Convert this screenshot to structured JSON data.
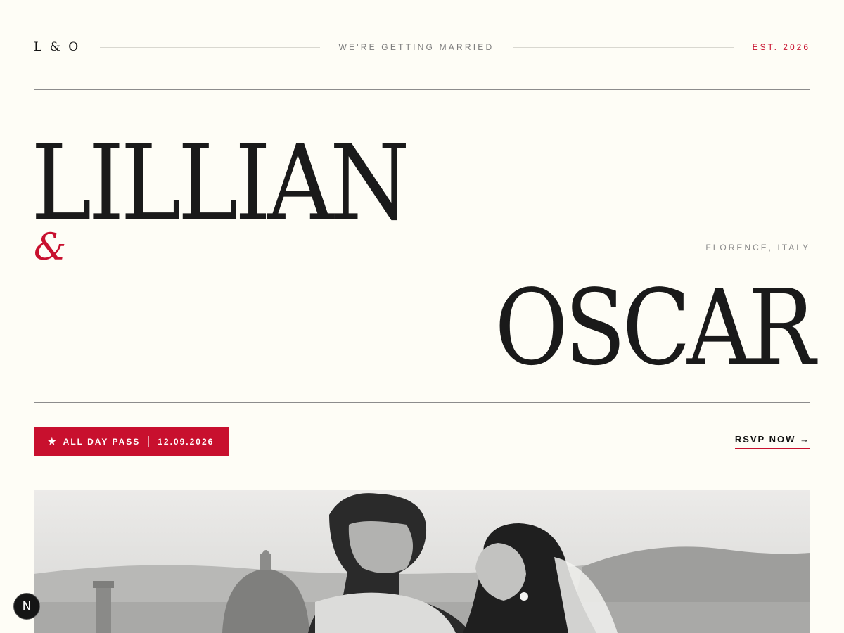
{
  "header": {
    "monogram": "L & O",
    "tagline": "WE'RE GETTING MARRIED",
    "established": "EST. 2026"
  },
  "hero": {
    "first_name": "LILLIAN",
    "ampersand": "&",
    "second_name": "OSCAR",
    "location": "FLORENCE, ITALY"
  },
  "actions": {
    "pass_star": "★",
    "pass_label": "ALL DAY PASS",
    "pass_date": "12.09.2026",
    "rsvp_label": "RSVP NOW →"
  },
  "dev_badge": {
    "label": "N",
    "icon": "nextjs-icon"
  },
  "colors": {
    "background": "#fefdf6",
    "accent": "#c8102e",
    "text": "#1a1a1a"
  }
}
